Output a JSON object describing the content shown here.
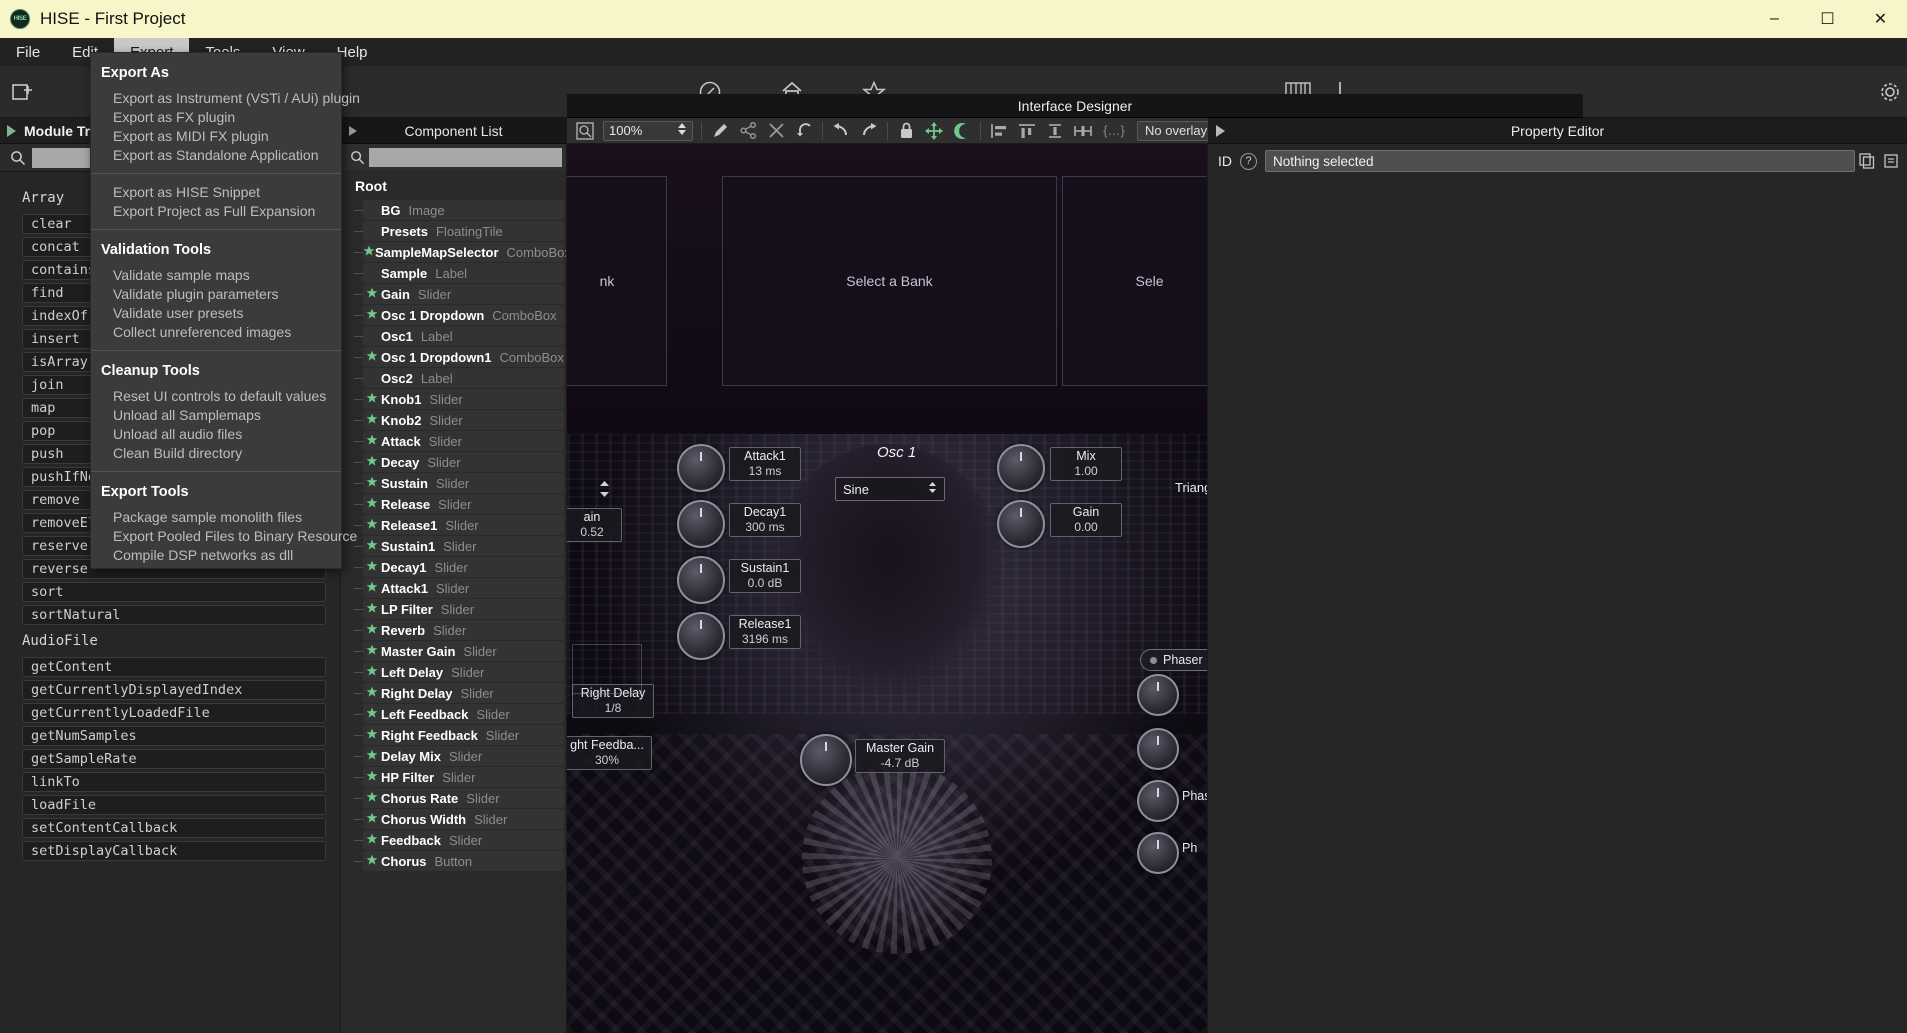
{
  "window": {
    "title": "HISE - First Project",
    "logo_text": "HISE",
    "minimize": "–",
    "maximize": "☐",
    "close": "✕"
  },
  "menubar": {
    "items": [
      {
        "label": "File",
        "active": false
      },
      {
        "label": "Edit",
        "active": false
      },
      {
        "label": "Export",
        "active": true
      },
      {
        "label": "Tools",
        "active": false
      },
      {
        "label": "View",
        "active": false
      },
      {
        "label": "Help",
        "active": false
      }
    ]
  },
  "export_menu": {
    "sections": [
      {
        "heading": "Export As",
        "items": [
          "Export as Instrument (VSTi / AUi) plugin",
          "Export as FX plugin",
          "Export as MIDI FX plugin",
          "Export as Standalone Application"
        ]
      },
      {
        "heading": "",
        "items": [
          "Export as HISE Snippet",
          "Export Project as Full Expansion"
        ]
      },
      {
        "heading": "Validation Tools",
        "items": [
          "Validate sample maps",
          "Validate plugin parameters",
          "Validate user presets",
          "Collect unreferenced images"
        ]
      },
      {
        "heading": "Cleanup Tools",
        "items": [
          "Reset UI controls to default values",
          "Unload all Samplemaps",
          "Unload all audio files",
          "Clean Build directory"
        ]
      },
      {
        "heading": "Export Tools",
        "items": [
          "Package sample monolith files",
          "Export Pooled Files to Binary Resource",
          "Compile DSP networks as dll"
        ]
      }
    ]
  },
  "toolbar": {
    "icons": [
      {
        "name": "new-preset-icon",
        "glyph": "⧉"
      },
      {
        "name": "metronome-icon",
        "glyph": "◔"
      },
      {
        "name": "home-icon",
        "glyph": "⌂"
      },
      {
        "name": "favourite-star-icon",
        "glyph": "☆"
      },
      {
        "name": "keyboard-icon",
        "glyph": "☷"
      },
      {
        "name": "plugin-icon",
        "glyph": "⚓"
      },
      {
        "name": "settings-gear-icon",
        "glyph": "⚙"
      }
    ],
    "preset_field_value": ""
  },
  "left_panel": {
    "module_tree_label": "Module Tree",
    "search_placeholder": "",
    "search_value": "",
    "groups": [
      {
        "name": "Array",
        "methods": [
          "clear",
          "concat",
          "contains",
          "find",
          "indexOf",
          "insert",
          "isArray",
          "join",
          "map",
          "pop",
          "push",
          "pushIfNotAlreadyThere",
          "remove",
          "removeElement",
          "reserve",
          "reverse",
          "sort",
          "sortNatural"
        ]
      },
      {
        "name": "AudioFile",
        "methods": [
          "getContent",
          "getCurrentlyDisplayedIndex",
          "getCurrentlyLoadedFile",
          "getNumSamples",
          "getSampleRate",
          "linkTo",
          "loadFile",
          "setContentCallback",
          "setDisplayCallback"
        ]
      }
    ]
  },
  "component_list": {
    "title": "Component List",
    "search_value": "",
    "root_label": "Root",
    "components": [
      {
        "name": "BG",
        "type": "Image",
        "starred": false
      },
      {
        "name": "Presets",
        "type": "FloatingTile",
        "starred": false
      },
      {
        "name": "SampleMapSelector",
        "type": "ComboBox",
        "starred": true
      },
      {
        "name": "Sample",
        "type": "Label",
        "starred": false
      },
      {
        "name": "Gain",
        "type": "Slider",
        "starred": true
      },
      {
        "name": "Osc 1 Dropdown",
        "type": "ComboBox",
        "starred": true
      },
      {
        "name": "Osc1",
        "type": "Label",
        "starred": false
      },
      {
        "name": "Osc 1 Dropdown1",
        "type": "ComboBox",
        "starred": true
      },
      {
        "name": "Osc2",
        "type": "Label",
        "starred": false
      },
      {
        "name": "Knob1",
        "type": "Slider",
        "starred": true
      },
      {
        "name": "Knob2",
        "type": "Slider",
        "starred": true
      },
      {
        "name": "Attack",
        "type": "Slider",
        "starred": true
      },
      {
        "name": "Decay",
        "type": "Slider",
        "starred": true
      },
      {
        "name": "Sustain",
        "type": "Slider",
        "starred": true
      },
      {
        "name": "Release",
        "type": "Slider",
        "starred": true
      },
      {
        "name": "Release1",
        "type": "Slider",
        "starred": true
      },
      {
        "name": "Sustain1",
        "type": "Slider",
        "starred": true
      },
      {
        "name": "Decay1",
        "type": "Slider",
        "starred": true
      },
      {
        "name": "Attack1",
        "type": "Slider",
        "starred": true
      },
      {
        "name": "LP Filter",
        "type": "Slider",
        "starred": true
      },
      {
        "name": "Reverb",
        "type": "Slider",
        "starred": true
      },
      {
        "name": "Master Gain",
        "type": "Slider",
        "starred": true
      },
      {
        "name": "Left Delay",
        "type": "Slider",
        "starred": true
      },
      {
        "name": "Right Delay",
        "type": "Slider",
        "starred": true
      },
      {
        "name": "Left Feedback",
        "type": "Slider",
        "starred": true
      },
      {
        "name": "Right Feedback",
        "type": "Slider",
        "starred": true
      },
      {
        "name": "Delay Mix",
        "type": "Slider",
        "starred": true
      },
      {
        "name": "HP Filter",
        "type": "Slider",
        "starred": true
      },
      {
        "name": "Chorus Rate",
        "type": "Slider",
        "starred": true
      },
      {
        "name": "Chorus Width",
        "type": "Slider",
        "starred": true
      },
      {
        "name": "Feedback",
        "type": "Slider",
        "starred": true
      },
      {
        "name": "Chorus",
        "type": "Button",
        "starred": true
      }
    ]
  },
  "interface_designer": {
    "title": "Interface Designer",
    "zoom_level": "100%",
    "overlay_label": "No overlay",
    "tools": [
      {
        "name": "zoom-to-fit-icon",
        "glyph": "⌕"
      },
      {
        "name": "edit-pencil-icon",
        "glyph": "✎"
      },
      {
        "name": "share-icon",
        "glyph": "≺"
      },
      {
        "name": "delete-x-icon",
        "glyph": "✕"
      },
      {
        "name": "rebuild-icon",
        "glyph": "↺"
      },
      {
        "name": "undo-icon",
        "glyph": "↶"
      },
      {
        "name": "redo-icon",
        "glyph": "↷"
      },
      {
        "name": "lock-icon",
        "glyph": "ὑ2"
      },
      {
        "name": "move-icon",
        "glyph": "✥"
      },
      {
        "name": "night-mode-icon",
        "glyph": "☾"
      },
      {
        "name": "align-left-icon",
        "glyph": "☰"
      },
      {
        "name": "align-center-icon",
        "glyph": "☷"
      },
      {
        "name": "align-vertical-icon",
        "glyph": "⤓"
      },
      {
        "name": "distribute-icon",
        "glyph": "↔"
      },
      {
        "name": "json-icon",
        "glyph": "{…}"
      }
    ]
  },
  "plugin_ui": {
    "bank_left_label": "nk",
    "bank_center_label": "Select a Bank",
    "bank_right_label": "Sele",
    "osc_title": "Osc 1",
    "waveform_value": "Sine",
    "waveform_right": "Triang",
    "phaser_label": "Phaser",
    "phaser_label2": "Phas",
    "phaser_label3": "Ph",
    "knob_labels": [
      {
        "name": "Attack1",
        "value": "13 ms"
      },
      {
        "name": "Decay1",
        "value": "300 ms"
      },
      {
        "name": "Sustain1",
        "value": "0.0 dB"
      },
      {
        "name": "Release1",
        "value": "3196 ms"
      },
      {
        "name": "Mix",
        "value": "1.00"
      },
      {
        "name": "Gain",
        "value": "0.00"
      },
      {
        "name": "Master Gain",
        "value": "-4.7 dB"
      },
      {
        "name": "Right Delay",
        "value": "1/8"
      },
      {
        "name": "ght Feedba...",
        "value": "30%"
      },
      {
        "name": "ain",
        "value": "0.52"
      }
    ]
  },
  "property_editor": {
    "title": "Property Editor",
    "id_label": "ID",
    "help_glyph": "?",
    "value": "Nothing selected",
    "icons": [
      {
        "name": "copy-properties-icon",
        "glyph": "⧉"
      },
      {
        "name": "paste-properties-icon",
        "glyph": "⎘"
      }
    ]
  },
  "colors": {
    "titlebar_bg": "#f7f6c8",
    "menu_active_bg": "#c9c9c9",
    "star_green": "#6fc98a",
    "panel_bg": "#262626"
  }
}
